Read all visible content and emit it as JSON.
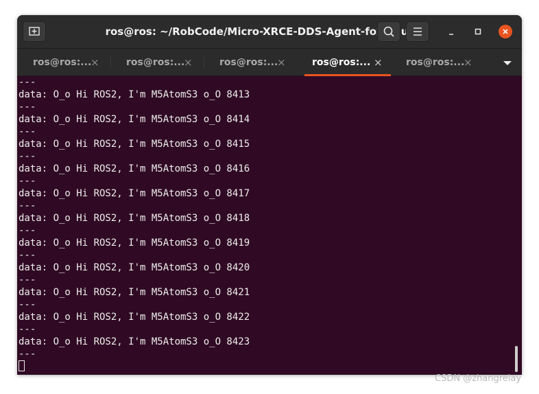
{
  "window": {
    "title": "ros@ros: ~/RobCode/Micro-XRCE-DDS-Agent-foxy/build",
    "accent_color": "#e95420",
    "background_color": "#300a24"
  },
  "titlebar": {
    "new_tab_icon": "new-tab-icon",
    "search_icon": "search-icon",
    "menu_icon": "hamburger-menu-icon",
    "minimize_icon": "minimize-icon",
    "maximize_icon": "maximize-icon",
    "close_icon": "close-icon"
  },
  "tabs": [
    {
      "label": "ros@ros:...",
      "close": "×",
      "active": false
    },
    {
      "label": "ros@ros:...",
      "close": "×",
      "active": false
    },
    {
      "label": "ros@ros:...",
      "close": "×",
      "active": false
    },
    {
      "label": "ros@ros:...",
      "close": "×",
      "active": true
    },
    {
      "label": "ros@ros:...",
      "close": "×",
      "active": false
    }
  ],
  "tab_menu_icon": "tab-list-dropdown-icon",
  "terminal": {
    "lines": [
      "---",
      "data: O_o Hi ROS2, I'm M5AtomS3 o_O 8413",
      "---",
      "data: O_o Hi ROS2, I'm M5AtomS3 o_O 8414",
      "---",
      "data: O_o Hi ROS2, I'm M5AtomS3 o_O 8415",
      "---",
      "data: O_o Hi ROS2, I'm M5AtomS3 o_O 8416",
      "---",
      "data: O_o Hi ROS2, I'm M5AtomS3 o_O 8417",
      "---",
      "data: O_o Hi ROS2, I'm M5AtomS3 o_O 8418",
      "---",
      "data: O_o Hi ROS2, I'm M5AtomS3 o_O 8419",
      "---",
      "data: O_o Hi ROS2, I'm M5AtomS3 o_O 8420",
      "---",
      "data: O_o Hi ROS2, I'm M5AtomS3 o_O 8421",
      "---",
      "data: O_o Hi ROS2, I'm M5AtomS3 o_O 8422",
      "---",
      "data: O_o Hi ROS2, I'm M5AtomS3 o_O 8423",
      "---"
    ]
  },
  "watermark": "CSDN @zhangrelay"
}
